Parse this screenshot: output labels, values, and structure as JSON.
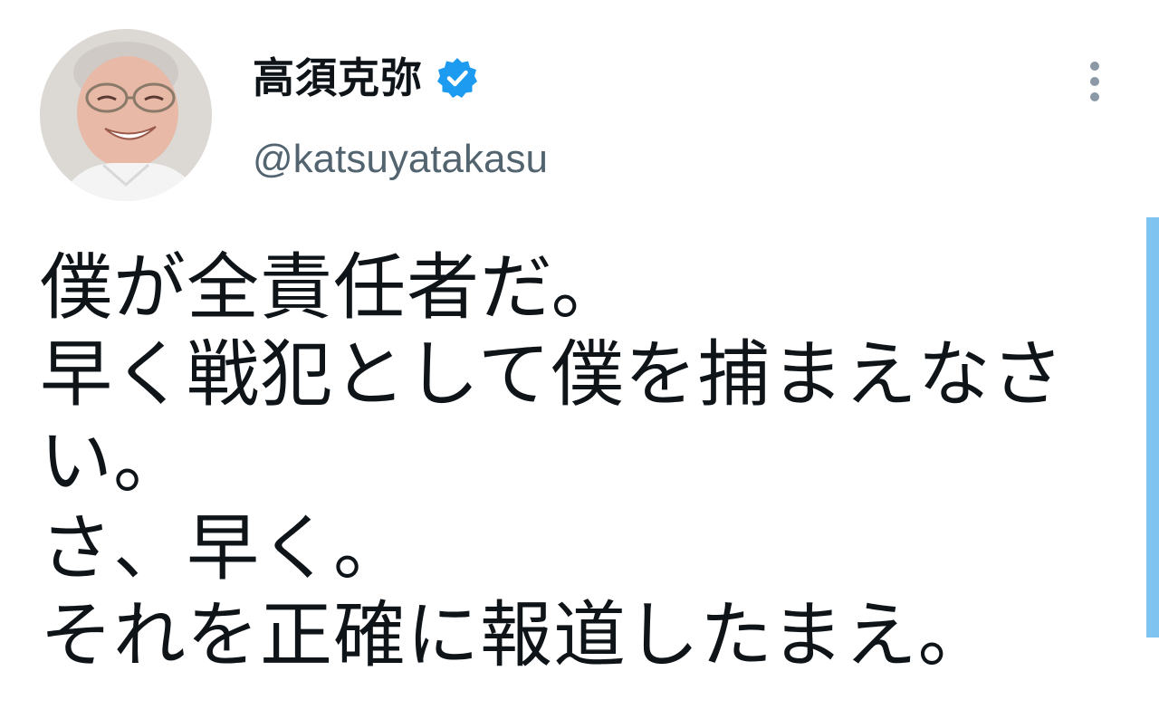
{
  "author": {
    "display_name": "高須克弥",
    "handle": "@katsuyatakasu",
    "verified": true,
    "verified_badge_color": "#1d9bf0"
  },
  "icons": {
    "avatar": "profile-photo",
    "verified": "verified-badge-icon",
    "more": "more-options-icon"
  },
  "tweet": {
    "lines": [
      "僕が全責任者だ。",
      "早く戦犯として僕を捕まえなさ",
      "い。",
      "さ、早く。",
      "それを正確に報道したまえ。"
    ]
  },
  "colors": {
    "text": "#0f1419",
    "secondary_text": "#536471",
    "scrollbar": "#7fc4f0",
    "background": "#ffffff"
  }
}
